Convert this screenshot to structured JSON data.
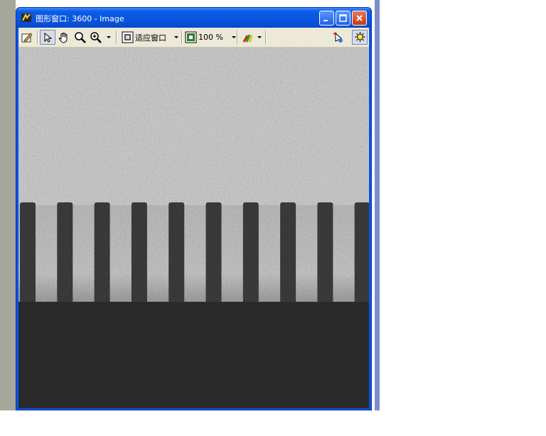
{
  "window": {
    "title": "图形窗口: 3600 - Image"
  },
  "toolbar": {
    "fit_window_label": "适应窗口",
    "zoom_label": "100 %"
  },
  "image": {
    "tooth_count": 10,
    "colors": {
      "top_region": "#c9c9c9",
      "tooth_dark": "#3b3b3b",
      "bottom_region": "#2d2d2d"
    }
  },
  "colors": {
    "titlebar": "#0a54e0",
    "toolbar": "#ece9d8",
    "desktop": "#a7a69b"
  }
}
